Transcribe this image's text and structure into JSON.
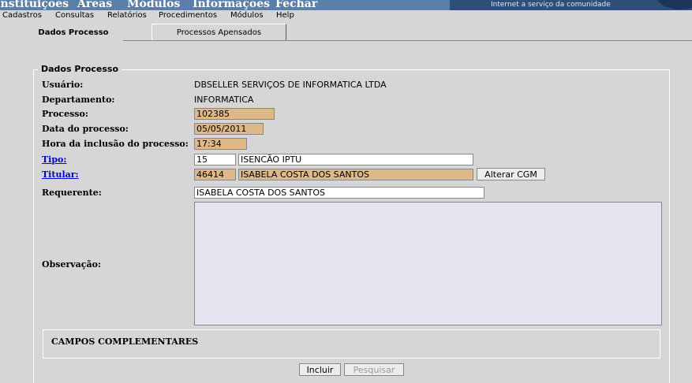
{
  "top_menu": [
    "Instituições",
    "Áreas",
    "Módulos",
    "Informações",
    "Fechar"
  ],
  "banner_text": "Internet a serviço da comunidade",
  "sub_menu": [
    "Cadastros",
    "Consultas",
    "Relatórios",
    "Procedimentos",
    "Módulos",
    "Help"
  ],
  "tabs": {
    "active": "Dados Processo",
    "inactive": "Processos Apensados"
  },
  "form": {
    "legend": "Dados Processo",
    "usuario_label": "Usuário:",
    "usuario_value": "DBSELLER SERVIÇOS DE INFORMATICA LTDA",
    "departamento_label": "Departamento:",
    "departamento_value": "INFORMATICA",
    "processo_label": "Processo:",
    "processo_value": "102385",
    "data_label": "Data do processo:",
    "data_value": "05/05/2011",
    "hora_label": "Hora da inclusão do processo:",
    "hora_value": "17:34",
    "tipo_label": "Tipo:",
    "tipo_code": "15",
    "tipo_desc": "ISENCÃO IPTU",
    "titular_label": "Titular:",
    "titular_code": "46414",
    "titular_name": "ISABELA COSTA DOS SANTOS",
    "alterar_cgm": "Alterar CGM",
    "requerente_label": "Requerente:",
    "requerente_value": "ISABELA COSTA DOS SANTOS",
    "observacao_label": "Observação:",
    "observacao_value": "",
    "campos_complementares": "CAMPOS COMPLEMENTARES"
  },
  "buttons": {
    "incluir": "Incluir",
    "pesquisar": "Pesquisar"
  },
  "colors": {
    "readonly_field": "#deb887",
    "top_bar": "#5a7fa8",
    "textarea": "#e6e4f0",
    "link": "#0000cc"
  }
}
